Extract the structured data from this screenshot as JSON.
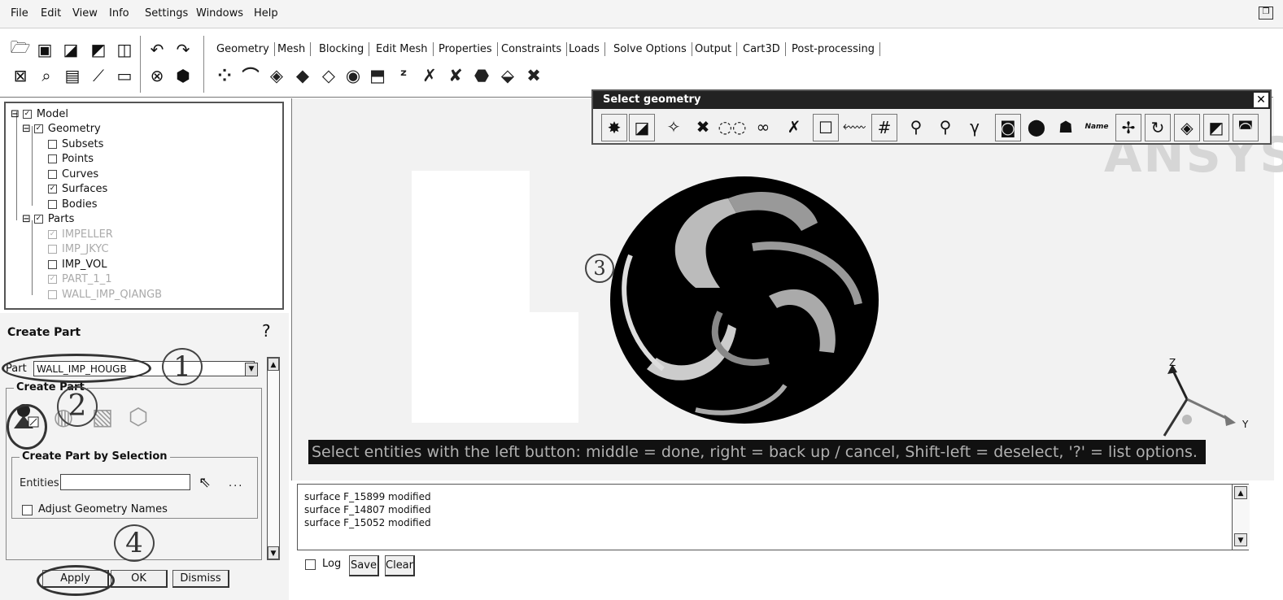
{
  "menu": [
    "File",
    "Edit",
    "View",
    "Info",
    "Settings",
    "Windows",
    "Help"
  ],
  "tabs": [
    "Geometry",
    "Mesh",
    "Blocking",
    "Edit Mesh",
    "Properties",
    "Constraints",
    "Loads",
    "Solve Options",
    "Output",
    "Cart3D",
    "Post-processing"
  ],
  "tree": {
    "model": "Model",
    "geometry": "Geometry",
    "subsets": "Subsets",
    "points": "Points",
    "curves": "Curves",
    "surfaces": "Surfaces",
    "bodies": "Bodies",
    "parts": "Parts",
    "part_items": [
      "IMPELLER",
      "IMP_JKYC",
      "IMP_VOL",
      "PART_1_1",
      "WALL_IMP_QIANGB"
    ]
  },
  "create_part": {
    "title": "Create Part",
    "part_label": "Part",
    "part_value": "WALL_IMP_HOUGB",
    "group_label": "Create Part",
    "by_selection_label": "Create Part by Selection",
    "entities_label": "Entities",
    "adjust_label": "Adjust Geometry Names",
    "apply": "Apply",
    "ok": "OK",
    "dismiss": "Dismiss"
  },
  "select_geometry": {
    "title": "Select geometry",
    "name_button": "Name"
  },
  "viewport": {
    "status": "Select entities with the left button: middle = done, right = back up / cancel, Shift-left = deselect, '?' = list options.",
    "axis_z": "Z",
    "axis_y": "Y"
  },
  "messages": [
    "surface F_15899 modified",
    "surface F_14807 modified",
    "surface F_15052 modified"
  ],
  "message_controls": {
    "log": "Log",
    "save": "Save",
    "clear": "Clear"
  },
  "callouts": [
    "1",
    "2",
    "3",
    "4"
  ]
}
